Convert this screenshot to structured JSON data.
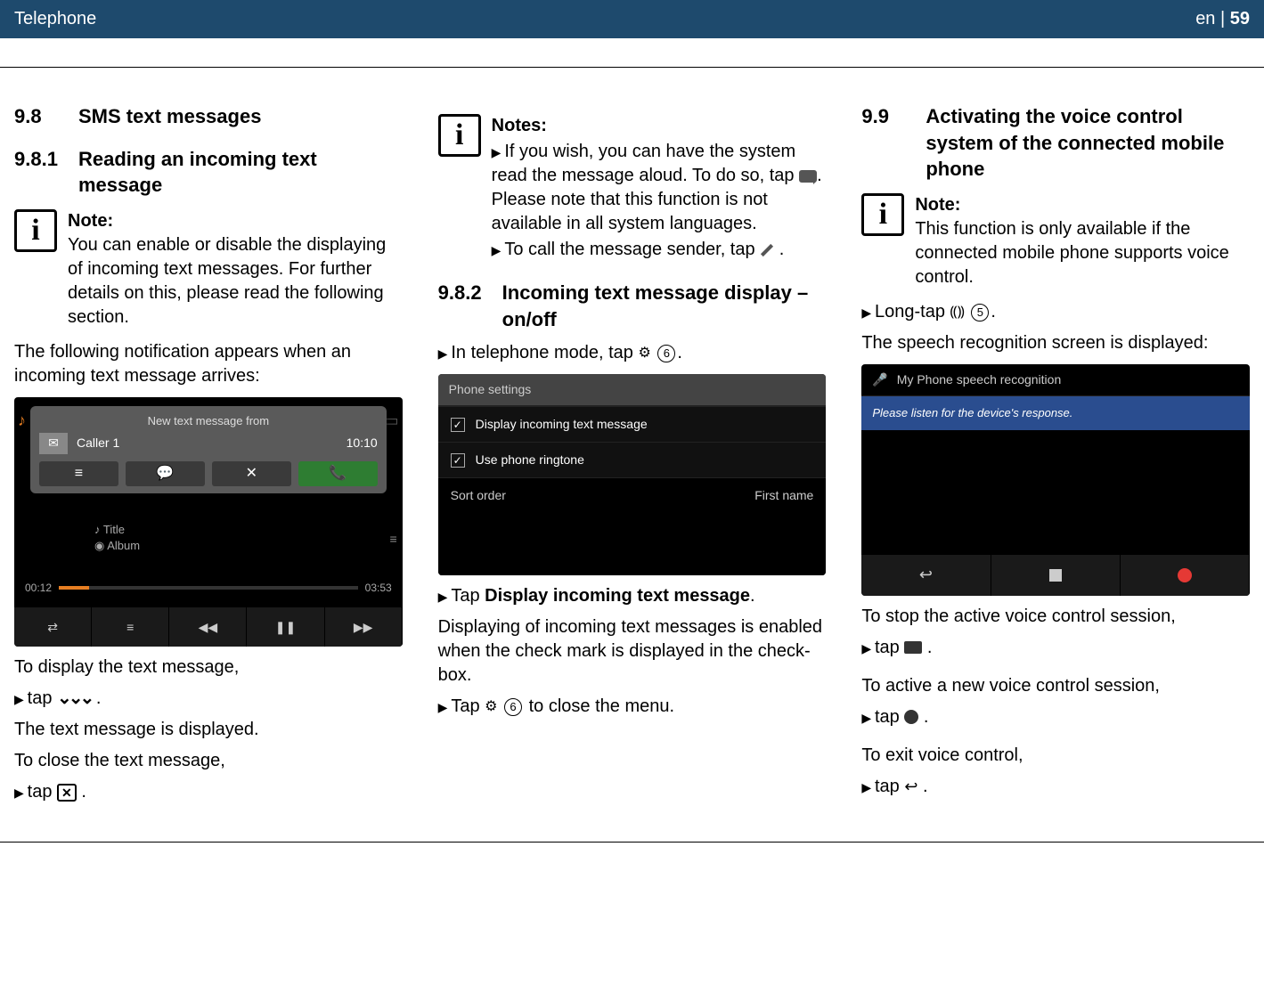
{
  "header": {
    "section": "Telephone",
    "lang": "en",
    "page": "59"
  },
  "col1": {
    "sec98_num": "9.8",
    "sec98_title": "SMS text messages",
    "sec981_num": "9.8.1",
    "sec981_title": "Reading an incoming text message",
    "note1_label": "Note:",
    "note1_body": "You can enable or disable the display­ing of incoming text messages. For further details on this, please read the following section.",
    "para1": "The following notification appears when an incoming text message arrives:",
    "ss1": {
      "popup_title": "New text message from",
      "caller": "Caller 1",
      "time": "10:10",
      "track_title": "Title",
      "album": "Album",
      "t_elapsed": "00:12",
      "t_total": "03:53"
    },
    "after_ss1_intro": "To display the text message,",
    "after_ss1_step": "tap",
    "after_ss1_step_suffix": ".",
    "after_ss1_result": "The text message is displayed.",
    "after_ss1_close_intro": "To close the text message,",
    "after_ss1_close_step": "tap",
    "after_ss1_close_suffix": "."
  },
  "col2": {
    "notes_label": "Notes:",
    "note_item1": "If you wish, you can have the system read the message aloud. To do so, tap",
    "note_item1_suffix": ". Please note that this func­tion is not available in all system languages.",
    "note_item2": "To call the message sender, tap",
    "note_item2_suffix": ".",
    "sec982_num": "9.8.2",
    "sec982_title": "Incoming text message dis­play – on/off",
    "step_topline": "In telephone mode, tap",
    "step_topline_num": "6",
    "step_topline_suffix": ".",
    "ss2": {
      "title": "Phone settings",
      "row1": "Display incoming text message",
      "row2": "Use phone ringtone",
      "row3_l": "Sort order",
      "row3_r": "First name"
    },
    "step_disp_prefix": "Tap ",
    "step_disp_bold": "Display incoming text message",
    "step_disp_suffix": ".",
    "disp_para": "Displaying of incoming text messages is enabled when the check mark is displayed in the check­box.",
    "step_close_prefix": "Tap",
    "step_close_num": "6",
    "step_close_suffix": " to close the menu."
  },
  "col3": {
    "sec99_num": "9.9",
    "sec99_title": "Activating the voice control system of the connected mobile phone",
    "note_label": "Note:",
    "note_body": "This function is only available if the connected mobile phone supports voice control.",
    "step_long_prefix": "Long-tap",
    "step_long_num": "5",
    "step_long_suffix": ".",
    "result_line": "The speech recognition screen is displayed:",
    "ss3": {
      "title": "My Phone speech recognition",
      "bluebar": "Please listen for the device's response."
    },
    "stop_intro": "To stop the active voice control session,",
    "stop_step": "tap",
    "stop_suffix": " .",
    "new_intro": "To active a new voice control session,",
    "new_step": "tap",
    "new_suffix": " .",
    "exit_intro": "To exit voice control,",
    "exit_step": "tap",
    "exit_suffix": " ."
  }
}
